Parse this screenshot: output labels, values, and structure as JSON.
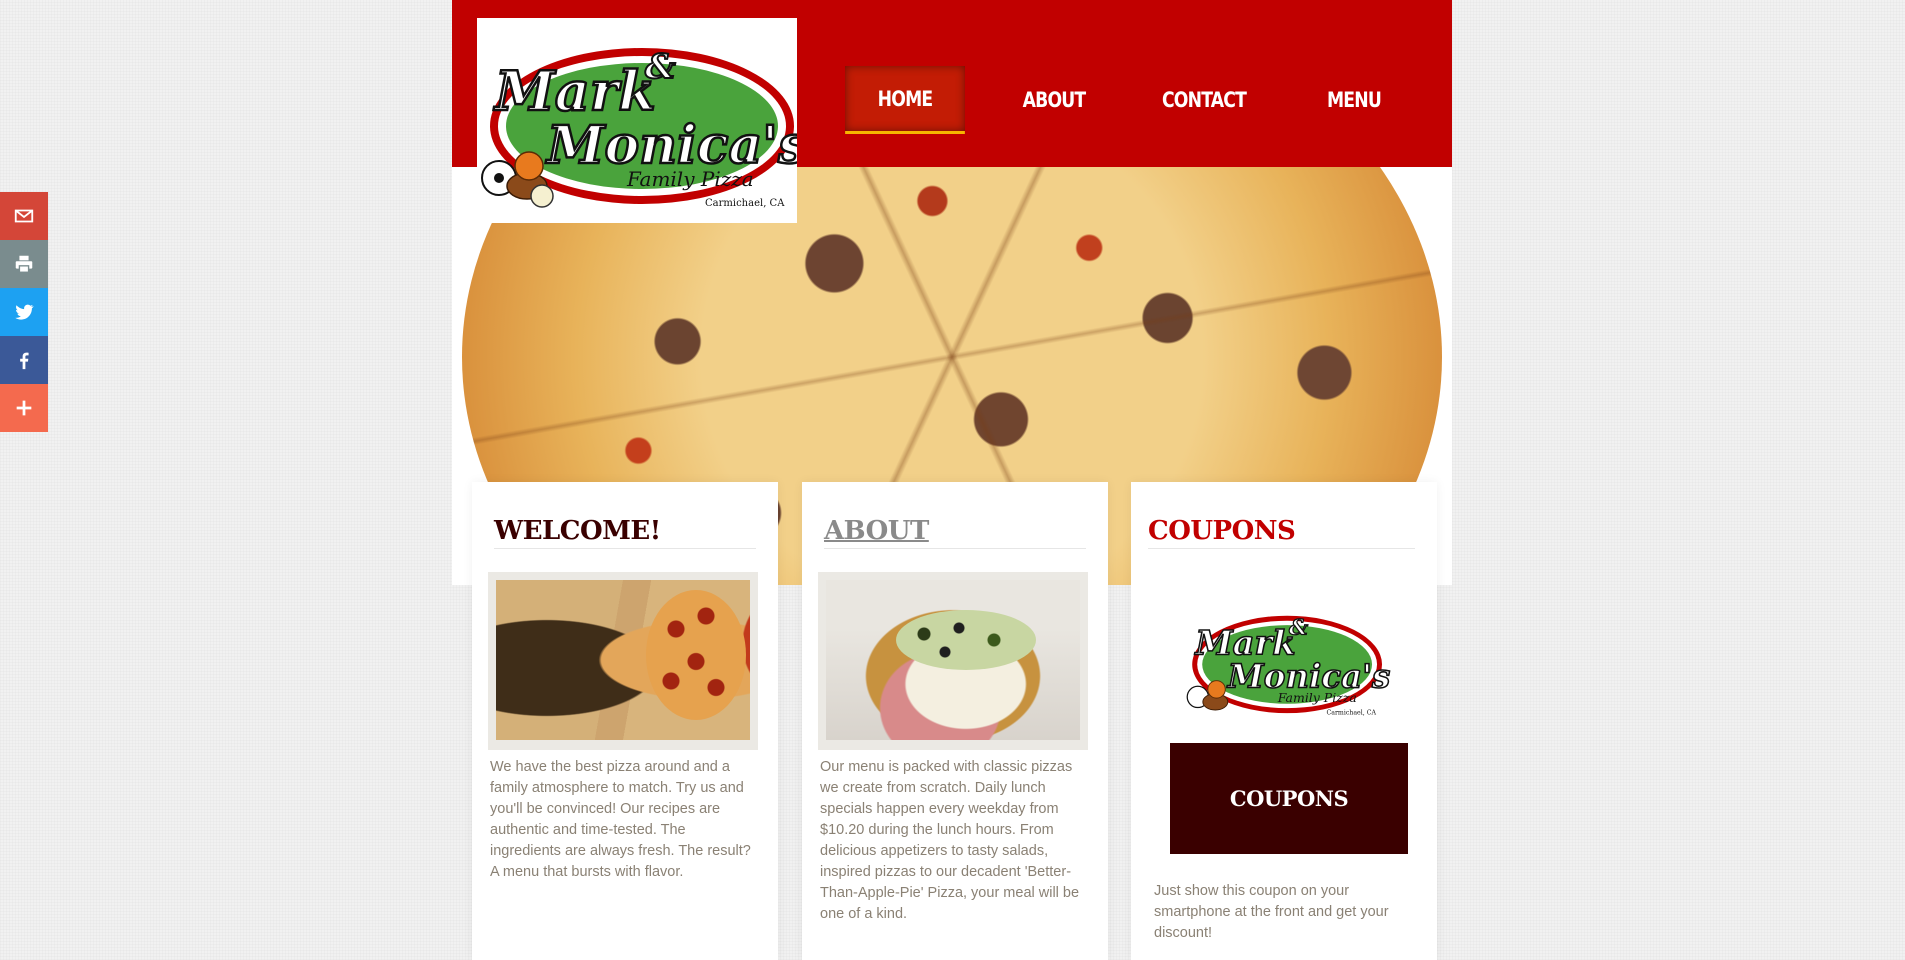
{
  "share_bar": {
    "items": [
      {
        "name": "gmail",
        "icon": "gmail-icon",
        "color": "#d44638"
      },
      {
        "name": "print",
        "icon": "print-icon",
        "color": "#7a8c8e"
      },
      {
        "name": "twitter",
        "icon": "twitter-icon",
        "color": "#1da1f2"
      },
      {
        "name": "facebook",
        "icon": "facebook-icon",
        "color": "#3b5998"
      },
      {
        "name": "more",
        "icon": "plus-icon",
        "color": "#f46a4e"
      }
    ]
  },
  "logo": {
    "line1": "Mark",
    "amp": "&",
    "line2": "Monica's",
    "line3": "Family Pizza",
    "line4": "Carmichael, CA"
  },
  "nav": {
    "items": [
      {
        "label": "HOME",
        "active": true
      },
      {
        "label": "ABOUT",
        "active": false
      },
      {
        "label": "CONTACT",
        "active": false
      },
      {
        "label": "MENU",
        "active": false
      }
    ]
  },
  "columns": {
    "welcome": {
      "title": "WELCOME!",
      "text": "We have the best pizza around and a family atmosphere to match. Try us and you'll be convinced! Our recipes are authentic and time-tested. The ingredients are always fresh. The result? A menu that bursts with flavor."
    },
    "about": {
      "title": "ABOUT",
      "text": "Our menu is packed with classic pizzas we create from scratch. Daily lunch specials happen every weekday from $10.20 during the lunch hours.  From delicious appetizers to tasty salads, inspired pizzas to our decadent 'Better-Than-Apple-Pie' Pizza, your meal will be one of a kind."
    },
    "coupons": {
      "title": "COUPONS",
      "button_label": "COUPONS",
      "text": "Just show this coupon on your smartphone at the front and get your discount!"
    }
  },
  "colors": {
    "header_red": "#c10000",
    "dark_maroon": "#3a0000",
    "active_underline": "#f7b500"
  }
}
